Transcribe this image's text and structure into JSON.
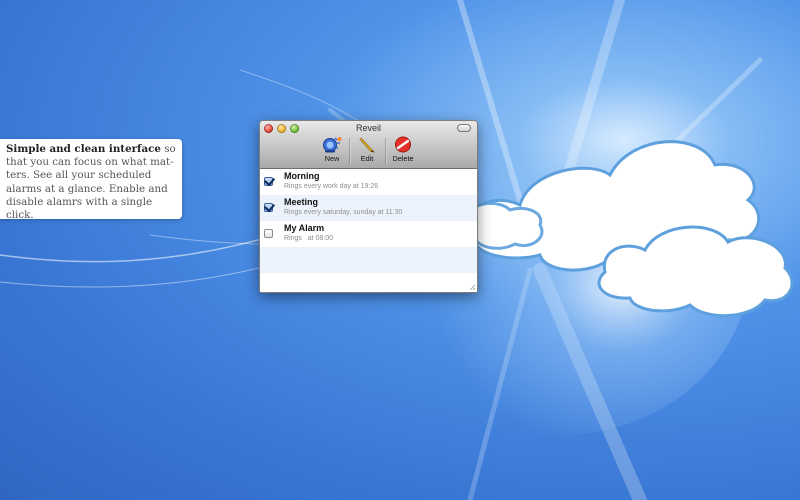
{
  "caption": {
    "bold": "Simple and clean interface",
    "lines": [
      " so",
      "that you can focus on what mat-",
      "ters. See all your scheduled",
      "alarms at a glance. Enable and",
      "disable alamrs with a single click."
    ]
  },
  "window": {
    "title": "Reveil",
    "toolbar": {
      "new_label": "New",
      "edit_label": "Edit",
      "delete_label": "Delete"
    }
  },
  "alarms": [
    {
      "name": "Morning",
      "description": "Rings every work day at 19:26",
      "enabled": true
    },
    {
      "name": "Meeting",
      "description": "Rings every saturday, sunday at 11:30",
      "enabled": true
    },
    {
      "name": "My Alarm",
      "description": "Rings   at 08:00",
      "enabled": false
    }
  ],
  "colors": {
    "desktop": "#3a78d6",
    "selection_row": "#edf3fd"
  }
}
